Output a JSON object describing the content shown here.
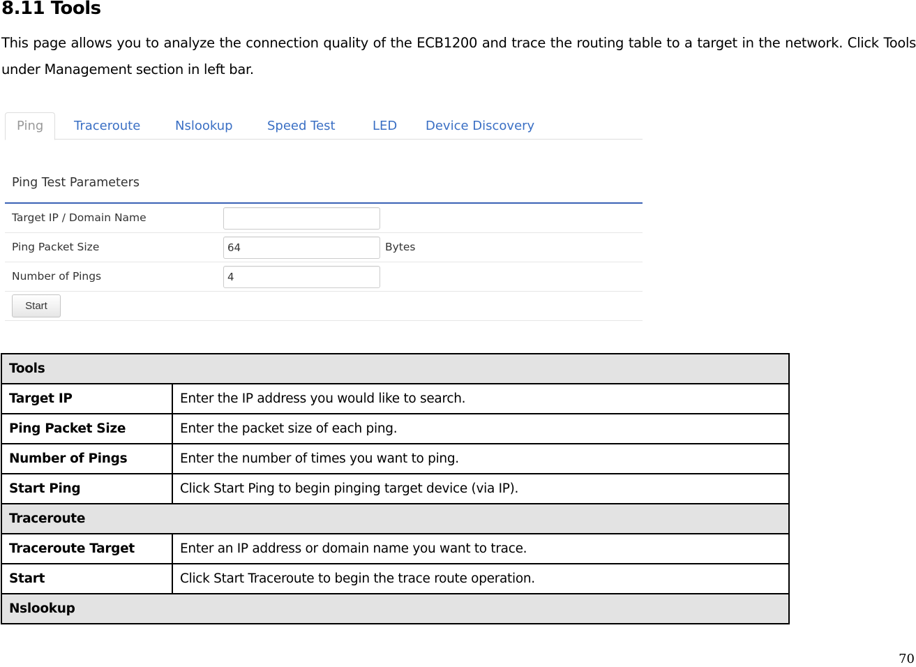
{
  "document": {
    "section_title": "8.11 Tools",
    "intro_text": "This page allows you to analyze the connection quality of the ECB1200 and trace the routing table to a target in the network. Click Tools under Management section in left bar.",
    "page_number": "70"
  },
  "screenshot": {
    "tabs": [
      {
        "label": "Ping",
        "active": true
      },
      {
        "label": "Traceroute",
        "active": false
      },
      {
        "label": "Nslookup",
        "active": false
      },
      {
        "label": "Speed Test",
        "active": false
      },
      {
        "label": "LED",
        "active": false
      },
      {
        "label": "Device Discovery",
        "active": false
      }
    ],
    "colors": {
      "tab_link": "#3a6fc4",
      "tab_active": "#999999",
      "section_rule": "#3a62b5"
    },
    "section_title": "Ping Test Parameters",
    "fields": [
      {
        "label": "Target IP / Domain Name",
        "value": "",
        "unit": ""
      },
      {
        "label": "Ping Packet Size",
        "value": "64",
        "unit": "Bytes"
      },
      {
        "label": "Number of Pings",
        "value": "4",
        "unit": ""
      }
    ],
    "start_button": "Start"
  },
  "table": {
    "rows": [
      {
        "type": "group",
        "key": "Tools"
      },
      {
        "type": "item",
        "key": "Target IP",
        "desc": "Enter the IP address you would like to search."
      },
      {
        "type": "item",
        "key": "Ping Packet Size",
        "desc": "Enter the packet size of each ping."
      },
      {
        "type": "item",
        "key": "Number of Pings",
        "desc": "Enter the number of times you want to ping."
      },
      {
        "type": "item",
        "key": "Start Ping",
        "desc": "Click Start Ping to begin pinging target device (via IP)."
      },
      {
        "type": "group",
        "key": "Traceroute"
      },
      {
        "type": "item",
        "key": "Traceroute Target",
        "desc": "Enter an IP address or domain name you want to trace."
      },
      {
        "type": "item",
        "key": "Start",
        "desc": "Click Start Traceroute to begin the trace route operation."
      },
      {
        "type": "group",
        "key": "Nslookup"
      }
    ]
  }
}
